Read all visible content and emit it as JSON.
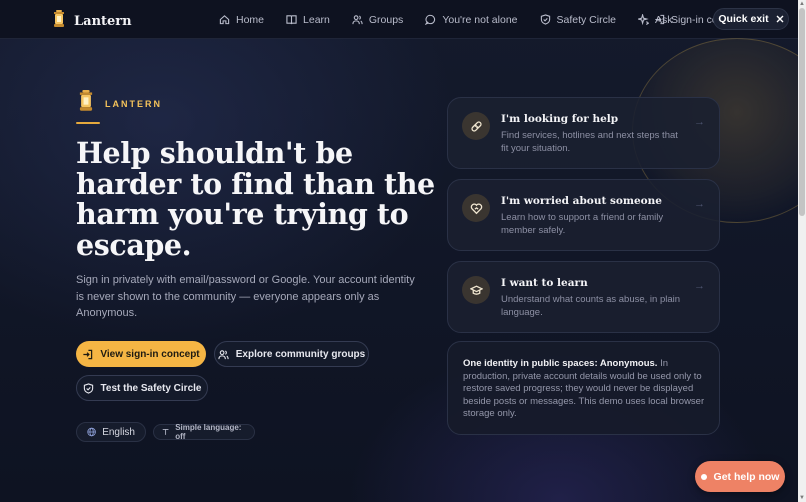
{
  "brand": {
    "name": "Lantern"
  },
  "nav": {
    "items": [
      {
        "label": "Home",
        "icon": "home-icon"
      },
      {
        "label": "Learn",
        "icon": "book-icon"
      },
      {
        "label": "Groups",
        "icon": "users-icon"
      },
      {
        "label": "You're not alone",
        "icon": "chat-icon"
      },
      {
        "label": "Safety Circle",
        "icon": "shield-icon"
      },
      {
        "label": "Ask",
        "icon": "sparkle-icon"
      }
    ],
    "signin_label": "Sign-in co",
    "quick_exit": "Quick exit"
  },
  "hero": {
    "eyebrow": "LANTERN",
    "title": "Help shouldn't be harder to find than the harm you're trying to escape.",
    "subtitle": "Sign in privately with email/password or Google. Your account identity is never shown to the community — everyone appears only as Anonymous.",
    "buttons": {
      "signin": "View sign-in concept",
      "groups": "Explore community groups",
      "safety": "Test the Safety Circle"
    },
    "language": "English",
    "simple_language": "Simple language: off"
  },
  "cards": [
    {
      "title": "I'm looking for help",
      "desc": "Find services, hotlines and next steps that fit your situation.",
      "icon": "bandage-icon"
    },
    {
      "title": "I'm worried about someone",
      "desc": "Learn how to support a friend or family member safely.",
      "icon": "heart-icon"
    },
    {
      "title": "I want to learn",
      "desc": "Understand what counts as abuse, in plain language.",
      "icon": "graduation-cap-icon"
    }
  ],
  "identity_note": {
    "bold": "One identity in public spaces: Anonymous.",
    "text": " In production, private account details would be used only to restore saved progress; they would never be displayed beside posts or messages. This demo uses local browser storage only."
  },
  "help_button": "Get help now",
  "colors": {
    "accent": "#f5b544",
    "background": "#0f1424",
    "help": "#ee8265"
  }
}
